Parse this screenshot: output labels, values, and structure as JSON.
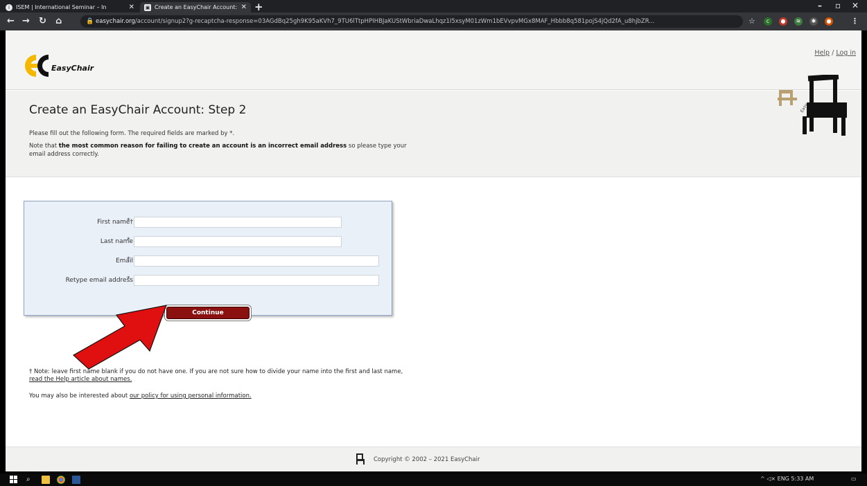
{
  "browser": {
    "tabs": [
      {
        "title": "ISEM | International Seminar – In",
        "icon": "isem-favicon"
      },
      {
        "title": "Create an EasyChair Account: Ste",
        "icon": "easychair-favicon"
      }
    ],
    "url_host": "easychair.org",
    "url_rest": "/account/signup2?g-recaptcha-response=03AGdBq25gh9K95aKVh7_9TU6lTtpHPIHBJaKUStWbriaDwaLhqz1I5xsyM01zWm1bEVvpvMGx8MAF_Hbbb8q581pojS4jQd2fA_u8hjbZR..."
  },
  "header": {
    "logo_text": "EasyChair",
    "help_link": "Help",
    "separator": " / ",
    "login_link": "Log in"
  },
  "page": {
    "title": "Create an EasyChair Account: Step 2",
    "intro": "Please fill out the following form. The required fields are marked by  *.",
    "note_prefix": "Note that ",
    "note_bold": "the most common reason for failing to create an account is an incorrect email address",
    "note_suffix": " so please type your",
    "note_line2": "email address correctly."
  },
  "form": {
    "first_name_label": "First name†:",
    "last_name_label": "Last name:",
    "email_label": "Email:",
    "retype_label": "Retype email address:",
    "required_marker": "*",
    "first_name_value": "",
    "last_name_value": "",
    "email_value": "",
    "retype_value": "",
    "continue_label": "Continue"
  },
  "notes": {
    "dagger_note": "† Note: leave first name blank if you do not have one. If you are not sure how to divide your name into the first and last name,",
    "help_link": "read the Help article about names.",
    "policy_prefix": "You may also be interested about ",
    "policy_link": "our policy for using personal information."
  },
  "footer": {
    "copyright": "Copyright © 2002 – 2021 EasyChair"
  },
  "taskbar": {
    "tray_text": "^  ◁×  ENG   5:33 AM"
  },
  "colors": {
    "continue_button": "#8b1111",
    "form_bg": "#eaf0f7",
    "arrow": "#e01010"
  }
}
